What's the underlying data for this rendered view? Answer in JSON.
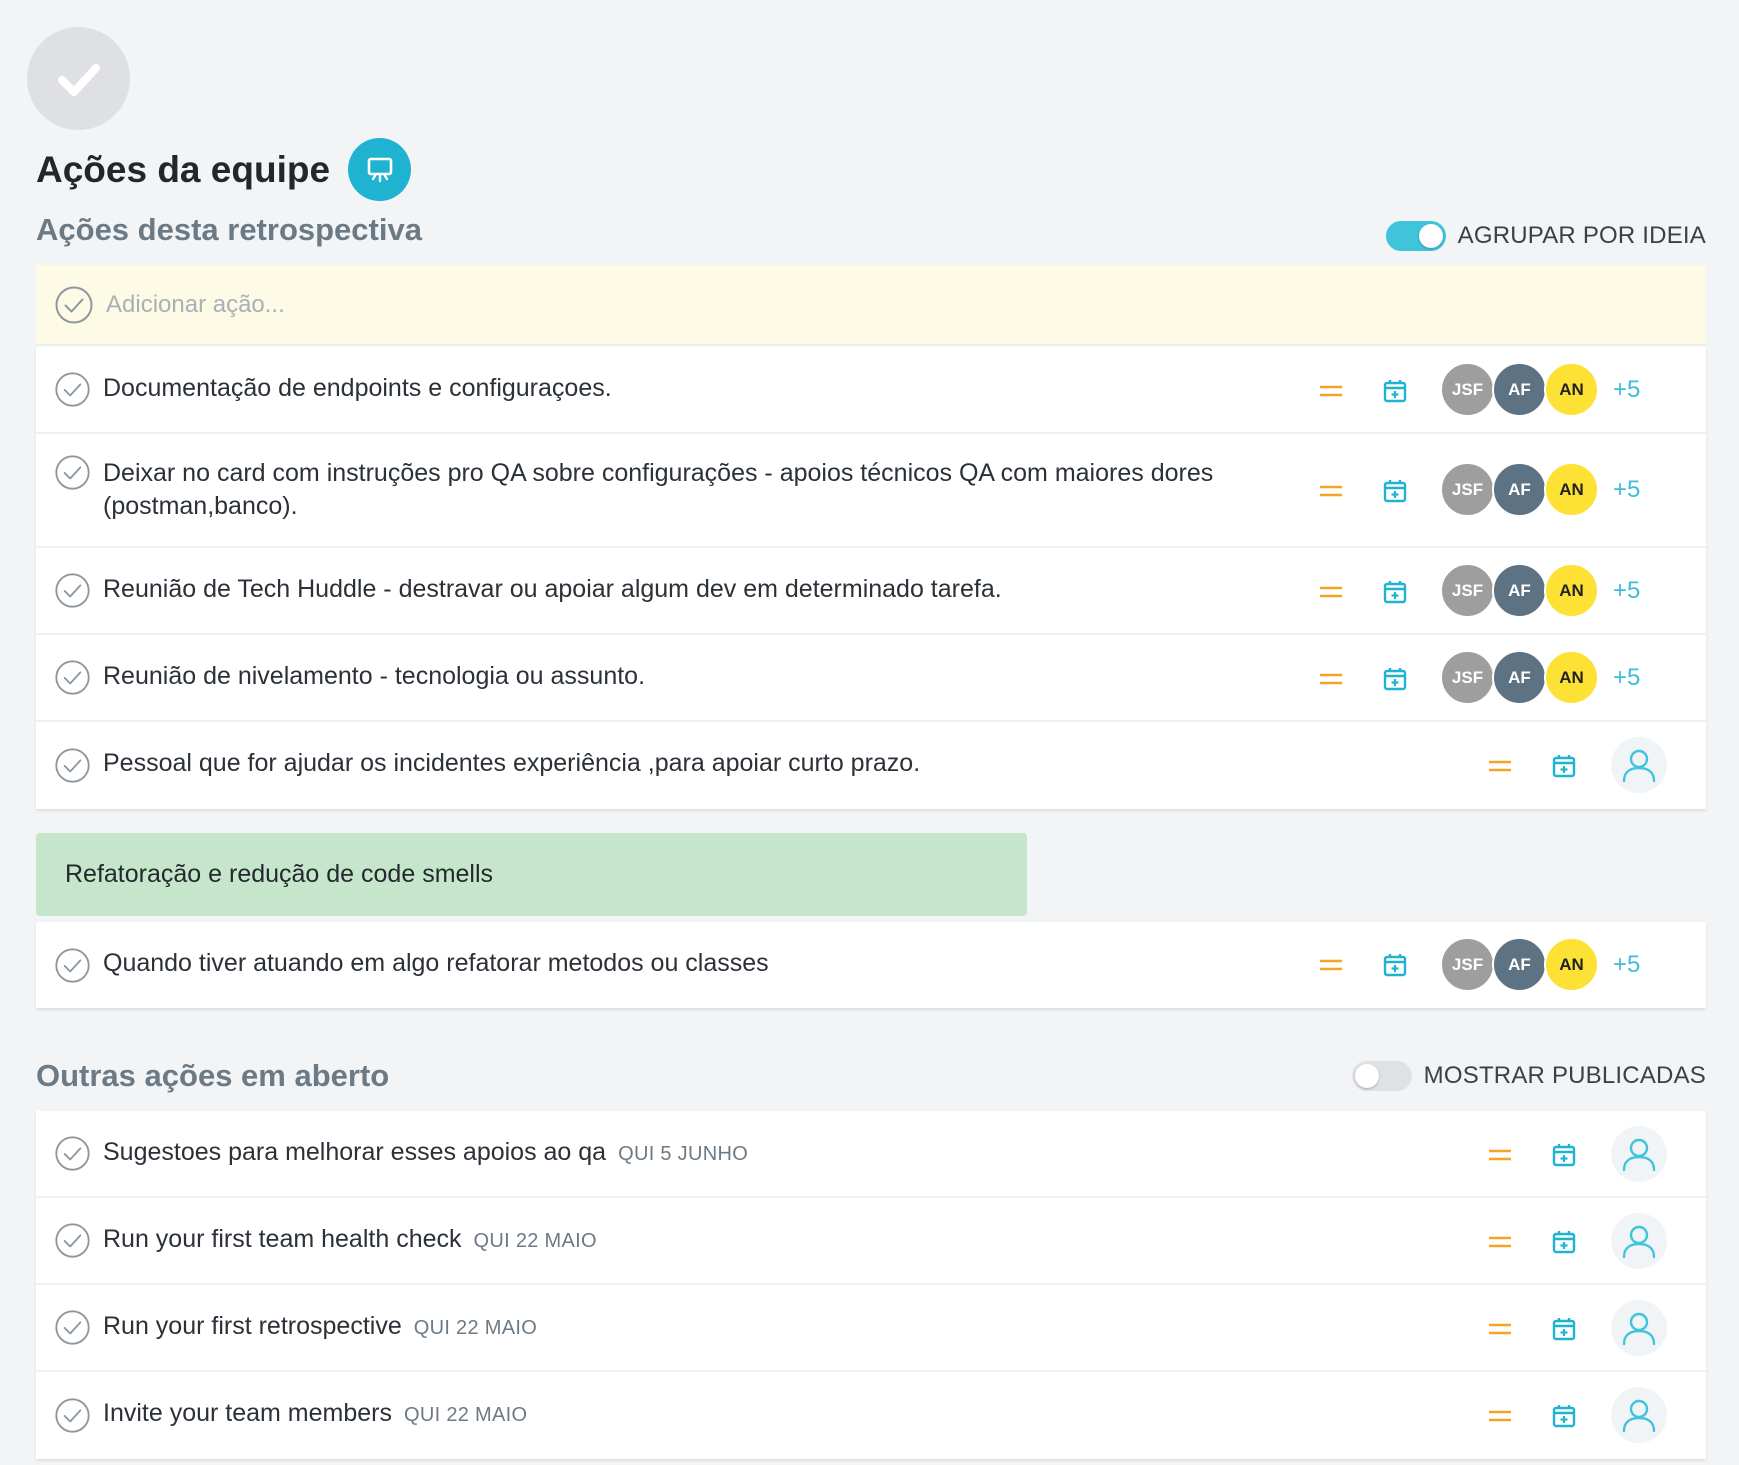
{
  "header": {
    "title": "Ações da equipe"
  },
  "retro_section": {
    "title": "Ações desta retrospectiva",
    "toggle_label": "AGRUPAR POR IDEIA",
    "toggle_on": true,
    "add_placeholder": "Adicionar ação...",
    "actions": [
      {
        "text": "Documentação de endpoints e configuraçoes.",
        "avatars": [
          "JSF",
          "AF",
          "AN"
        ],
        "more": "+5"
      },
      {
        "text": "Deixar no card com instruções pro QA sobre configurações - apoios técnicos QA com maiores dores (postman,banco).",
        "avatars": [
          "JSF",
          "AF",
          "AN"
        ],
        "more": "+5"
      },
      {
        "text": "Reunião de Tech Huddle - destravar ou apoiar algum dev em determinado tarefa.",
        "avatars": [
          "JSF",
          "AF",
          "AN"
        ],
        "more": "+5"
      },
      {
        "text": "Reunião de nivelamento - tecnologia ou assunto.",
        "avatars": [
          "JSF",
          "AF",
          "AN"
        ],
        "more": "+5"
      },
      {
        "text": "Pessoal que for ajudar os incidentes experiência ,para apoiar curto prazo."
      }
    ],
    "idea_group": {
      "title": "Refatoração e redução de code smells",
      "actions": [
        {
          "text": "Quando tiver atuando em algo refatorar metodos ou classes",
          "avatars": [
            "JSF",
            "AF",
            "AN"
          ],
          "more": "+5"
        }
      ]
    }
  },
  "open_section": {
    "title": "Outras ações em aberto",
    "toggle_label": "MOSTRAR PUBLICADAS",
    "toggle_on": false,
    "actions": [
      {
        "text": "Sugestoes para melhorar esses apoios ao qa",
        "date": "QUI 5 JUNHO"
      },
      {
        "text": "Run your first team health check",
        "date": "QUI 22 MAIO"
      },
      {
        "text": "Run your first retrospective",
        "date": "QUI 22 MAIO"
      },
      {
        "text": "Invite your team members",
        "date": "QUI 22 MAIO"
      }
    ]
  },
  "colors": {
    "accent": "#1fb3d1",
    "priority": "#f5a524",
    "avatar_jsf": "#9e9e9e",
    "avatar_af": "#5d7282",
    "avatar_an": "#fde135",
    "add_row_bg": "#fdfae6",
    "idea_card_bg": "#c6e6cb"
  },
  "icons": {
    "check": "check-circle-icon",
    "priority": "priority-equal-icon",
    "calendar": "calendar-add-icon",
    "assign": "user-icon",
    "board": "presentation-board-icon"
  }
}
